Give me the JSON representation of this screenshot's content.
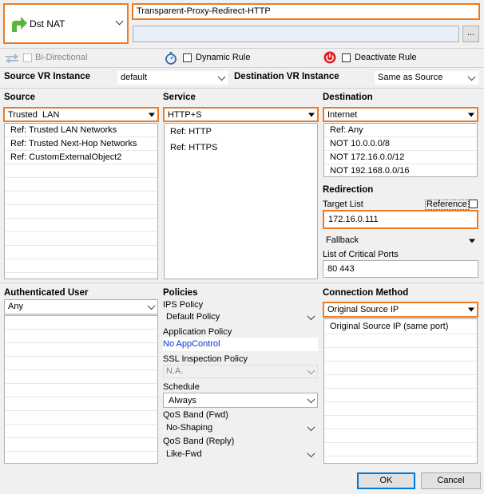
{
  "rule_type": {
    "label": "Dst NAT",
    "icon": "arrow-right-icon"
  },
  "rule_name": "Transparent-Proxy-Redirect-HTTP",
  "rule_description": "",
  "browse_button": "...",
  "options": {
    "bidirectional": "Bi-Directional",
    "dynamic_rule": "Dynamic Rule",
    "deactivate_rule": "Deactivate Rule"
  },
  "vr": {
    "source_label": "Source VR Instance",
    "source_value": "default",
    "dest_label": "Destination VR Instance",
    "dest_value": "Same as Source"
  },
  "source": {
    "label": "Source",
    "value": "Trusted  LAN",
    "items": [
      "Ref: Trusted LAN Networks",
      "Ref: Trusted Next-Hop Networks",
      "Ref: CustomExternalObject2"
    ]
  },
  "service": {
    "label": "Service",
    "value": "HTTP+S",
    "items": [
      "Ref: HTTP",
      "Ref: HTTPS"
    ]
  },
  "destination": {
    "label": "Destination",
    "value": "Internet",
    "items": [
      "Ref: Any",
      "NOT 10.0.0.0/8",
      "NOT 172.16.0.0/12",
      "NOT 192.168.0.0/16"
    ]
  },
  "redirection": {
    "label": "Redirection",
    "target_list_label": "Target List",
    "reference_label": "Reference",
    "target_value": "172.16.0.111",
    "fallback_value": "Fallback",
    "critical_ports_label": "List of Critical Ports",
    "critical_ports_value": "80 443"
  },
  "auth_user": {
    "label": "Authenticated User",
    "value": "Any"
  },
  "policies": {
    "label": "Policies",
    "ips_label": "IPS Policy",
    "ips_value": "Default Policy",
    "app_label": "Application Policy",
    "app_value": "No AppControl",
    "ssl_label": "SSL Inspection Policy",
    "ssl_value": "N.A.",
    "schedule_label": "Schedule",
    "schedule_value": "Always",
    "qos_fwd_label": "QoS Band (Fwd)",
    "qos_fwd_value": "No-Shaping",
    "qos_reply_label": "QoS Band (Reply)",
    "qos_reply_value": "Like-Fwd"
  },
  "connection": {
    "label": "Connection Method",
    "value": "Original Source IP",
    "items": [
      "Original Source IP (same port)"
    ]
  },
  "buttons": {
    "ok": "OK",
    "cancel": "Cancel"
  },
  "colors": {
    "highlight": "#f07a20",
    "icon_green": "#5bb33b",
    "link": "#0033cc"
  }
}
